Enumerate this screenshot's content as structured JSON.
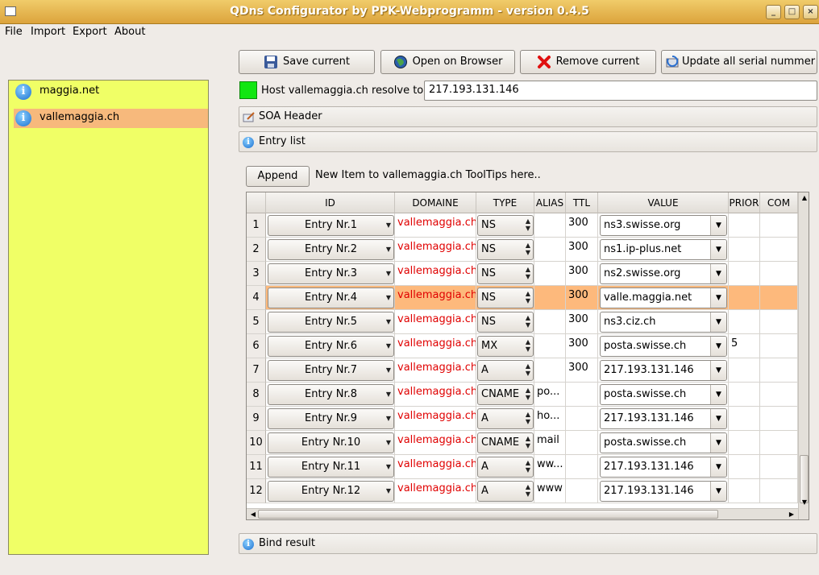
{
  "window": {
    "title": "QDns Configurator by PPK-Webprogramm - version 0.4.5"
  },
  "menu": [
    "File",
    "Import",
    "Export",
    "About"
  ],
  "tree": [
    {
      "label": "maggia.net",
      "selected": false
    },
    {
      "label": "vallemaggia.ch",
      "selected": true
    }
  ],
  "toolbar": {
    "save": "Save current",
    "open": "Open on Browser",
    "remove": "Remove current",
    "update": "Update all serial nummer"
  },
  "host": {
    "label": "Host vallemaggia.ch resolve to:",
    "value": "217.193.131.146",
    "status_color": "#11e611"
  },
  "sections": {
    "soa": "SOA Header",
    "entry": "Entry list",
    "bind": "Bind result"
  },
  "append": {
    "button": "Append",
    "hint": "New Item to vallemaggia.ch  ToolTips here.."
  },
  "table": {
    "columns": [
      "ID",
      "DOMAINE",
      "TYPE",
      "ALIAS",
      "TTL",
      "VALUE",
      "PRIOR",
      "COM"
    ],
    "rows": [
      {
        "n": "1",
        "id": "Entry Nr.1",
        "domain": "vallemaggia.ch",
        "type": "NS",
        "alias": "",
        "ttl": "300",
        "value": "ns3.swisse.org",
        "prio": ""
      },
      {
        "n": "2",
        "id": "Entry Nr.2",
        "domain": "vallemaggia.ch",
        "type": "NS",
        "alias": "",
        "ttl": "300",
        "value": "ns1.ip-plus.net",
        "prio": ""
      },
      {
        "n": "3",
        "id": "Entry Nr.3",
        "domain": "vallemaggia.ch",
        "type": "NS",
        "alias": "",
        "ttl": "300",
        "value": "ns2.swisse.org",
        "prio": ""
      },
      {
        "n": "4",
        "id": "Entry Nr.4",
        "domain": "vallemaggia.ch",
        "type": "NS",
        "alias": "",
        "ttl": "300",
        "value": "valle.maggia.net",
        "prio": "",
        "selected": true
      },
      {
        "n": "5",
        "id": "Entry Nr.5",
        "domain": "vallemaggia.ch",
        "type": "NS",
        "alias": "",
        "ttl": "300",
        "value": "ns3.ciz.ch",
        "prio": ""
      },
      {
        "n": "6",
        "id": "Entry Nr.6",
        "domain": "vallemaggia.ch",
        "type": "MX",
        "alias": "",
        "ttl": "300",
        "value": "posta.swisse.ch",
        "prio": "5"
      },
      {
        "n": "7",
        "id": "Entry Nr.7",
        "domain": "vallemaggia.ch",
        "type": "A",
        "alias": "",
        "ttl": "300",
        "value": "217.193.131.146",
        "prio": ""
      },
      {
        "n": "8",
        "id": "Entry Nr.8",
        "domain": "vallemaggia.ch",
        "type": "CNAME",
        "alias": "po...",
        "ttl": "",
        "value": "posta.swisse.ch",
        "prio": ""
      },
      {
        "n": "9",
        "id": "Entry Nr.9",
        "domain": "vallemaggia.ch",
        "type": "A",
        "alias": "ho...",
        "ttl": "",
        "value": "217.193.131.146",
        "prio": ""
      },
      {
        "n": "10",
        "id": "Entry Nr.10",
        "domain": "vallemaggia.ch",
        "type": "CNAME",
        "alias": "mail",
        "ttl": "",
        "value": "posta.swisse.ch",
        "prio": ""
      },
      {
        "n": "11",
        "id": "Entry Nr.11",
        "domain": "vallemaggia.ch",
        "type": "A",
        "alias": "ww...",
        "ttl": "",
        "value": "217.193.131.146",
        "prio": ""
      },
      {
        "n": "12",
        "id": "Entry Nr.12",
        "domain": "vallemaggia.ch",
        "type": "A",
        "alias": "www",
        "ttl": "",
        "value": "217.193.131.146",
        "prio": ""
      }
    ]
  }
}
